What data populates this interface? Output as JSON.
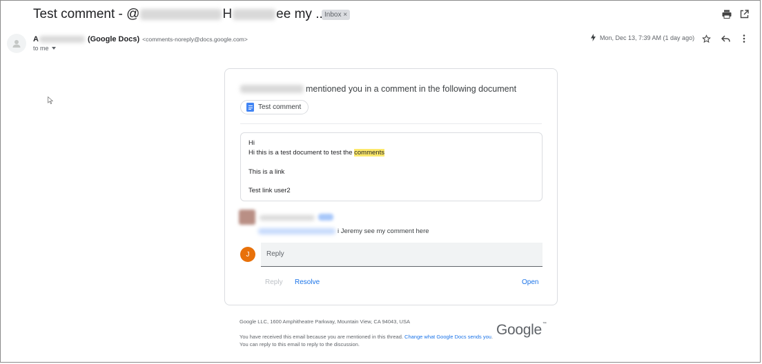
{
  "header": {
    "subject_prefix": "Test comment - @",
    "subject_mid": "H",
    "subject_suffix": "ee my ...",
    "label_chip": "Inbox ×",
    "print_icon": "print-icon",
    "popout_icon": "open-in-new-window-icon"
  },
  "message": {
    "sender_initial": "A",
    "sender_name": "(Google Docs)",
    "sender_email": "<comments-noreply@docs.google.com>",
    "recipient": "to me",
    "date": "Mon, Dec 13, 7:39 AM (1 day ago)",
    "icons": [
      "important-bolt-icon",
      "star-icon",
      "reply-icon",
      "more-vert-icon"
    ]
  },
  "card": {
    "mention_text": "mentioned you in a comment in the following document",
    "doc_chip": "Test comment",
    "quote_lines": {
      "line1": "Hi",
      "line2_pre": "Hi this is a test document to test the ",
      "line2_highlight": "comments",
      "line3": "This is a link",
      "line4": "Test link user2"
    },
    "comment_text": "i Jeremy see my comment here",
    "reply_avatar_initial": "J",
    "reply_placeholder": "Reply",
    "actions": {
      "reply": "Reply",
      "resolve": "Resolve",
      "open": "Open"
    }
  },
  "footer": {
    "address": "Google LLC, 1600 Amphitheatre Parkway, Mountain View, CA 94043, USA",
    "note_pre": "You have received this email because you are mentioned in this thread. ",
    "note_link": "Change what Google Docs sends you",
    "note_post": ". You can reply to this email to reply to the discussion.",
    "logo": "Google"
  },
  "colors": {
    "link": "#1a73e8",
    "highlight": "#fce86b",
    "avatar_j": "#e8710a",
    "docs_blue": "#4285f4"
  }
}
